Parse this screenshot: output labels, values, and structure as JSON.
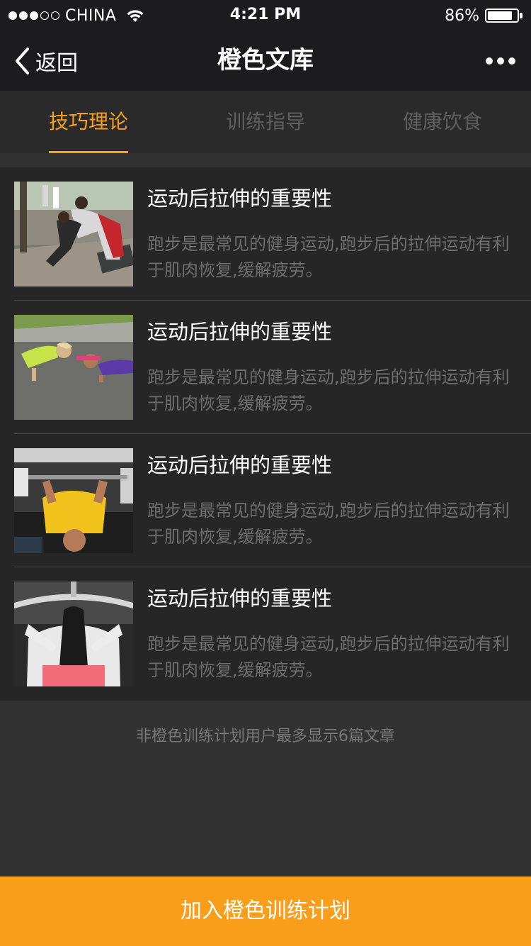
{
  "status_bar": {
    "carrier": "CHINA",
    "time": "4:21 PM",
    "battery_percent": "86%",
    "battery_level": 0.86,
    "signal_bars_filled": 3,
    "signal_bars_total": 5
  },
  "nav": {
    "back_label": "返回",
    "title": "橙色文库",
    "more_icon": "more-icon"
  },
  "tabs": [
    {
      "label": "技巧理论",
      "active": true
    },
    {
      "label": "训练指导",
      "active": false
    },
    {
      "label": "健康饮食",
      "active": false
    }
  ],
  "articles": [
    {
      "title": "运动后拉伸的重要性",
      "desc": "跑步是最常见的健身运动,跑步后的拉伸运动有利于肌肉恢复,缓解疲劳。"
    },
    {
      "title": "运动后拉伸的重要性",
      "desc": "跑步是最常见的健身运动,跑步后的拉伸运动有利于肌肉恢复,缓解疲劳。"
    },
    {
      "title": "运动后拉伸的重要性",
      "desc": "跑步是最常见的健身运动,跑步后的拉伸运动有利于肌肉恢复,缓解疲劳。"
    },
    {
      "title": "运动后拉伸的重要性",
      "desc": "跑步是最常见的健身运动,跑步后的拉伸运动有利于肌肉恢复,缓解疲劳。"
    }
  ],
  "footer_note": "非橙色训练计划用户最多显示6篇文章",
  "join_button": "加入橙色训练计划",
  "colors": {
    "accent": "#f7a01d",
    "button": "#f99e1b",
    "bar_bg": "#1c1c1e",
    "list_bg": "#262626",
    "page_bg": "#323232"
  }
}
